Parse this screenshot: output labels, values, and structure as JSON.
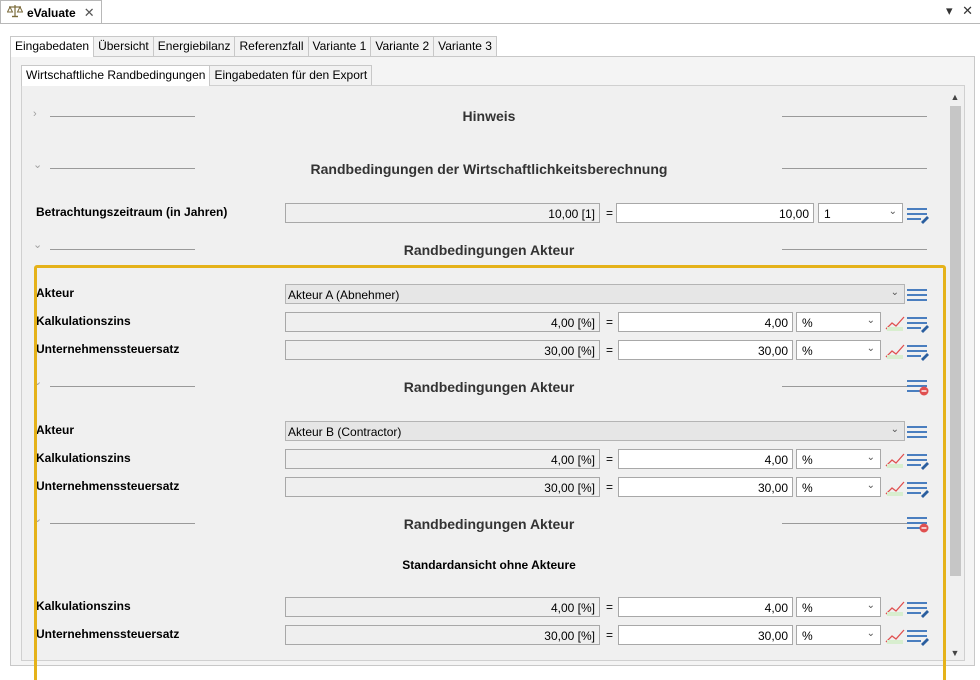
{
  "view": {
    "title": "eValuate",
    "menu_glyph": "▾ ✕"
  },
  "tabs": [
    "Eingabedaten",
    "Übersicht",
    "Energiebilanz",
    "Referenzfall",
    "Variante 1",
    "Variante 2",
    "Variante 3"
  ],
  "subtabs": [
    "Wirtschaftliche Randbedingungen",
    "Eingabedaten für den Export"
  ],
  "sections": {
    "hinweis": "Hinweis",
    "wirtschaft": "Randbedingungen der Wirtschaftlichkeitsberechnung",
    "akteur": "Randbedingungen Akteur",
    "standard": "Standardansicht ohne Akteure"
  },
  "period": {
    "label": "Betrachtungszeitraum (in Jahren)",
    "value": "10,00 [1]",
    "result": "10,00",
    "unit": "1"
  },
  "labels": {
    "akteur": "Akteur",
    "zins": "Kalkulationszins",
    "steuer": "Unternehmenssteuersatz",
    "eq": "="
  },
  "akteur_a": {
    "name": "Akteur A (Abnehmer)",
    "zins_value": "4,00 [%]",
    "zins_result": "4,00",
    "zins_unit": "%",
    "steuer_value": "30,00 [%]",
    "steuer_result": "30,00",
    "steuer_unit": "%"
  },
  "akteur_b": {
    "name": "Akteur B (Contractor)",
    "zins_value": "4,00 [%]",
    "zins_result": "4,00",
    "zins_unit": "%",
    "steuer_value": "30,00 [%]",
    "steuer_result": "30,00",
    "steuer_unit": "%"
  },
  "standard": {
    "zins_value": "4,00 [%]",
    "zins_result": "4,00",
    "zins_unit": "%",
    "steuer_value": "30,00 [%]",
    "steuer_result": "30,00",
    "steuer_unit": "%"
  },
  "glyphs": {
    "chevron_right": "›",
    "chevron_down": "⌄",
    "dropdown": "⌄",
    "scroll_up": "▲",
    "scroll_down": "▼"
  },
  "colors": {
    "highlight": "#e5b21a",
    "icon_blue": "#4a7ebf",
    "icon_red": "#e05050",
    "icon_green": "#6ab04c"
  }
}
